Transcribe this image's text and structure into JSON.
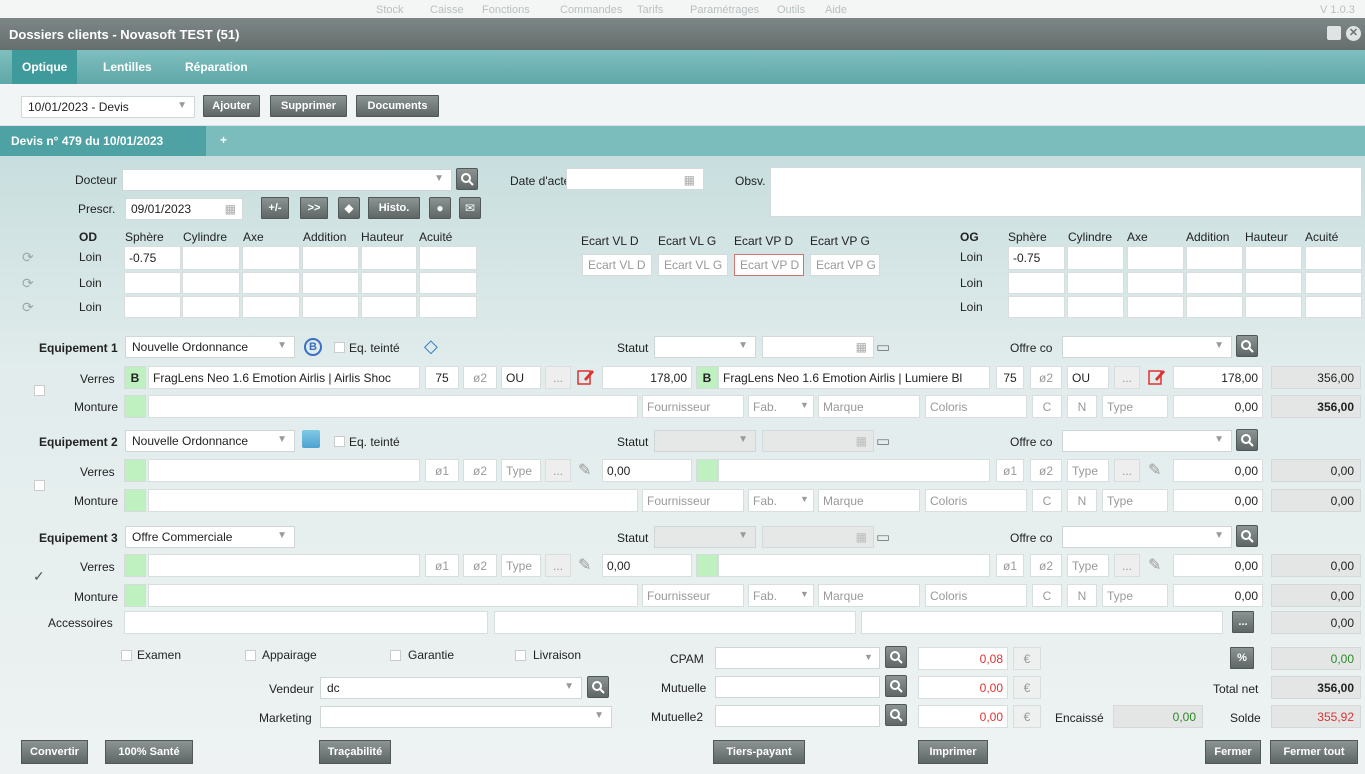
{
  "topmenu": {
    "items": [
      "Stock",
      "Caisse",
      "Fonctions",
      "Commandes",
      "Tarifs",
      "Paramétrages",
      "Outils",
      "Aide"
    ],
    "version": "V 1.0.3"
  },
  "window": {
    "title": "Dossiers clients - Novasoft TEST (51)"
  },
  "tabs": [
    "Optique",
    "Lentilles",
    "Réparation"
  ],
  "toolbar": {
    "devis_select": "10/01/2023 - Devis",
    "ajouter": "Ajouter",
    "supprimer": "Supprimer",
    "documents": "Documents"
  },
  "subtab": {
    "label": "Devis n° 479 du 10/01/2023",
    "plus": "+"
  },
  "form": {
    "docteur_label": "Docteur",
    "docteur_value": "",
    "date_acte_label": "Date d'acte",
    "obsv_label": "Obsv.",
    "prescr_label": "Prescr.",
    "prescr_date": "09/01/2023",
    "btn_plusminus": "+/-",
    "btn_next": ">>",
    "btn_histo": "Histo."
  },
  "refraction": {
    "od_label": "OD",
    "og_label": "OG",
    "headers": [
      "Sphère",
      "Cylindre",
      "Axe",
      "Addition",
      "Hauteur",
      "Acuité"
    ],
    "rows": [
      "Loin",
      "Loin",
      "Loin"
    ],
    "od_sphere": "-0.75",
    "og_sphere": "-0.75",
    "ecart_headers": [
      "Ecart VL D",
      "Ecart VL G",
      "Ecart VP D",
      "Ecart VP G"
    ],
    "ecart_placeholders": [
      "Ecart VL D",
      "Ecart VL G",
      "Ecart VP D",
      "Ecart VP G"
    ]
  },
  "equip1": {
    "label": "Equipement 1",
    "select": "Nouvelle Ordonnance",
    "teinte": "Eq. teinté",
    "statut": "Statut",
    "offre": "Offre co",
    "verres_label": "Verres",
    "monture_label": "Monture",
    "od_b": "B",
    "od_lens": "FragLens Neo 1.6 Emotion Airlis | Airlis Shoc",
    "od_diam": "75",
    "od_d2": "ø2",
    "od_type": "OU",
    "od_dots": "...",
    "od_price": "178,00",
    "og_b": "B",
    "og_lens": "FragLens Neo 1.6 Emotion Airlis | Lumiere Bl",
    "og_diam": "75",
    "og_d2": "ø2",
    "og_type": "OU",
    "og_dots": "...",
    "og_price": "178,00",
    "total_verres": "356,00",
    "fournisseur": "Fournisseur",
    "fab": "Fab.",
    "marque": "Marque",
    "coloris": "Coloris",
    "c": "C",
    "n": "N",
    "type": "Type",
    "monture_price": "0,00",
    "total": "356,00"
  },
  "equip2": {
    "label": "Equipement 2",
    "select": "Nouvelle Ordonnance",
    "teinte": "Eq. teinté",
    "statut": "Statut",
    "offre": "Offre co",
    "verres_label": "Verres",
    "monture_label": "Monture",
    "d1": "ø1",
    "d2": "ø2",
    "type": "Type",
    "dots": "...",
    "price_od": "0,00",
    "price_og": "0,00",
    "total_verres": "0,00",
    "fournisseur": "Fournisseur",
    "fab": "Fab.",
    "marque": "Marque",
    "coloris": "Coloris",
    "c": "C",
    "n": "N",
    "monture_price": "0,00",
    "total": "0,00"
  },
  "equip3": {
    "label": "Equipement 3",
    "select": "Offre Commerciale",
    "statut": "Statut",
    "offre": "Offre co",
    "verres_label": "Verres",
    "monture_label": "Monture",
    "d1": "ø1",
    "d2": "ø2",
    "type": "Type",
    "dots": "...",
    "price_od": "0,00",
    "price_og": "0,00",
    "total_verres": "0,00",
    "fournisseur": "Fournisseur",
    "fab": "Fab.",
    "marque": "Marque",
    "coloris": "Coloris",
    "c": "C",
    "n": "N",
    "monture_price": "0,00",
    "total": "0,00",
    "checked": true
  },
  "accessoires": {
    "label": "Accessoires",
    "total": "0,00",
    "dots": "..."
  },
  "options": [
    "Examen",
    "Appairage",
    "Garantie",
    "Livraison"
  ],
  "vendeur": {
    "label": "Vendeur",
    "value": "dc"
  },
  "marketing": {
    "label": "Marketing"
  },
  "payers": [
    {
      "label": "CPAM",
      "amount": "0,08"
    },
    {
      "label": "Mutuelle",
      "amount": "0,00"
    },
    {
      "label": "Mutuelle2",
      "amount": "0,00"
    }
  ],
  "currency": "€",
  "encaisse": {
    "label": "Encaissé",
    "value": "0,00"
  },
  "totals": {
    "percent_btn": "%",
    "percent_value": "0,00",
    "total_net_label": "Total net",
    "total_net": "356,00",
    "solde_label": "Solde",
    "solde": "355,92"
  },
  "bottom": [
    "Convertir",
    "100% Santé",
    "Traçabilité",
    "Tiers-payant",
    "Imprimer",
    "Fermer",
    "Fermer tout"
  ],
  "colors": {
    "accent": "#5fa7a8",
    "title": "#656d6d",
    "red": "#d33333",
    "green_box": "#bff0c0"
  }
}
